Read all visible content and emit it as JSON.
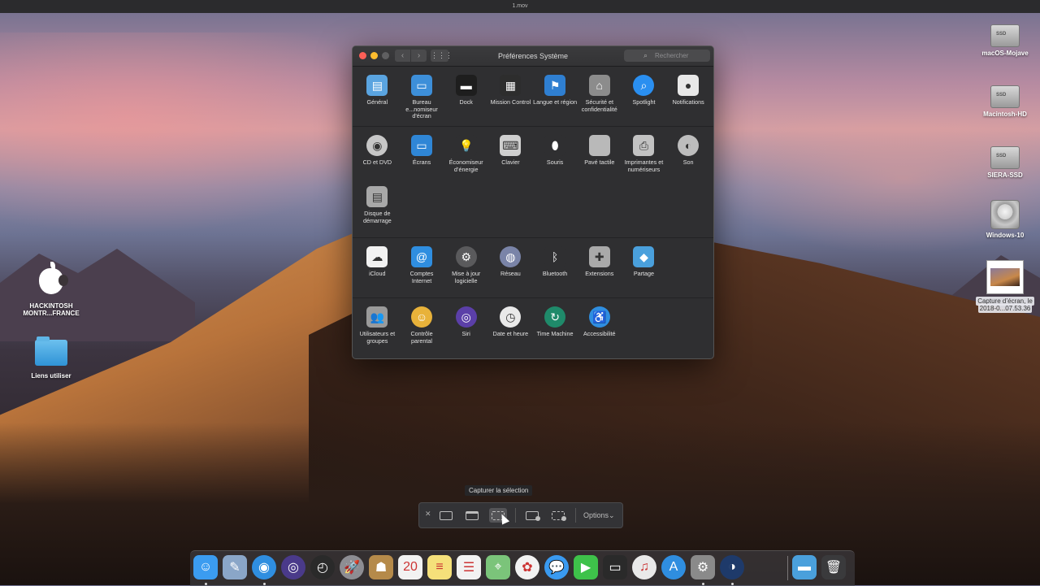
{
  "topbar": {
    "title": "1.mov"
  },
  "desktop": {
    "right": [
      {
        "label": "macOS-Mojave"
      },
      {
        "label": "Macintosh-HD"
      },
      {
        "label": "SIERA-SSD"
      },
      {
        "label": "Windows-10"
      },
      {
        "label1": "Capture d’écran, le",
        "label2": "2018-0...07.53.36"
      }
    ],
    "left": [
      {
        "label1": "HACKINTOSH",
        "label2": "MONTR...FRANCE"
      },
      {
        "label": "Liens utiliser"
      }
    ]
  },
  "window": {
    "title": "Préférences Système",
    "search_placeholder": "Rechercher",
    "back": "‹",
    "forward": "›",
    "grid": "⋮⋮⋮",
    "row1": [
      {
        "label": "Général",
        "icon": "general-icon",
        "color": "#5aa4e0",
        "glyph": "▤"
      },
      {
        "label": "Bureau e...nomiseur d'écran",
        "icon": "desktop-screensaver-icon",
        "color": "#3d8fd9",
        "glyph": "▭"
      },
      {
        "label": "Dock",
        "icon": "dock-icon",
        "color": "#1e1e1e",
        "glyph": "▬"
      },
      {
        "label": "Mission Control",
        "icon": "mission-control-icon",
        "color": "#2d2d2d",
        "glyph": "▦"
      },
      {
        "label": "Langue et région",
        "icon": "language-region-icon",
        "color": "#2f7fd1",
        "glyph": "⚑"
      },
      {
        "label": "Sécurité et confidentialité",
        "icon": "security-icon",
        "color": "#8c8c8c",
        "glyph": "⌂"
      },
      {
        "label": "Spotlight",
        "icon": "spotlight-icon",
        "color": "#2a8ff0",
        "glyph": "⌕"
      },
      {
        "label": "Notifications",
        "icon": "notifications-icon",
        "color": "#e8e8e8",
        "glyph": "●"
      }
    ],
    "row2": [
      {
        "label": "CD et DVD",
        "icon": "cd-dvd-icon",
        "color": "#c7c7c7",
        "glyph": "◉"
      },
      {
        "label": "Écrans",
        "icon": "displays-icon",
        "color": "#2f86d6",
        "glyph": "▭"
      },
      {
        "label": "Économiseur d’énergie",
        "icon": "energy-saver-icon",
        "color": "#2f2f31",
        "glyph": "💡"
      },
      {
        "label": "Clavier",
        "icon": "keyboard-icon",
        "color": "#cfcfcf",
        "glyph": "⌨"
      },
      {
        "label": "Souris",
        "icon": "mouse-icon",
        "color": "#2f2f31",
        "glyph": "⬮"
      },
      {
        "label": "Pavé tactile",
        "icon": "trackpad-icon",
        "color": "#b9b9b9",
        "glyph": ""
      },
      {
        "label": "Imprimantes et numériseurs",
        "icon": "printer-icon",
        "color": "#c2c2c2",
        "glyph": "⎙"
      },
      {
        "label": "Son",
        "icon": "sound-icon",
        "color": "#bdbdbd",
        "glyph": "◐"
      },
      {
        "label": "Disque de démarrage",
        "icon": "startup-disk-icon",
        "color": "#a8a8a8",
        "glyph": "▤"
      }
    ],
    "row3": [
      {
        "label": "iCloud",
        "icon": "icloud-icon",
        "color": "#f2f2f2",
        "glyph": "☁"
      },
      {
        "label": "Comptes Internet",
        "icon": "internet-accounts-icon",
        "color": "#2f8ee0",
        "glyph": "@"
      },
      {
        "label": "Mise à jour logicielle",
        "icon": "software-update-icon",
        "color": "#5a5a5c",
        "glyph": "⚙"
      },
      {
        "label": "Réseau",
        "icon": "network-icon",
        "color": "#7a84a8",
        "glyph": "◍"
      },
      {
        "label": "Bluetooth",
        "icon": "bluetooth-icon",
        "color": "#2f2f31",
        "glyph": "ᛒ"
      },
      {
        "label": "Extensions",
        "icon": "extensions-icon",
        "color": "#a9a9a9",
        "glyph": "✚"
      },
      {
        "label": "Partage",
        "icon": "sharing-icon",
        "color": "#4aa0dc",
        "glyph": "◆"
      }
    ],
    "row4": [
      {
        "label": "Utilisateurs et groupes",
        "icon": "users-groups-icon",
        "color": "#9a9a9a",
        "glyph": "👥"
      },
      {
        "label": "Contrôle parental",
        "icon": "parental-controls-icon",
        "color": "#e8b23a",
        "glyph": "☺"
      },
      {
        "label": "Siri",
        "icon": "siri-icon",
        "color": "#5b3fa8",
        "glyph": "◎"
      },
      {
        "label": "Date et heure",
        "icon": "date-time-icon",
        "color": "#e9e9e9",
        "glyph": "◷"
      },
      {
        "label": "Time Machine",
        "icon": "time-machine-icon",
        "color": "#1f8a6a",
        "glyph": "↻"
      },
      {
        "label": "Accessibilité",
        "icon": "accessibility-icon",
        "color": "#2f8ee0",
        "glyph": "♿"
      }
    ]
  },
  "capture": {
    "tooltip": "Capturer la sélection",
    "close": "✕",
    "options": "Options",
    "chevron": "⌄"
  },
  "dock": [
    {
      "icon": "finder-icon",
      "color": "#3b9cf0",
      "glyph": "☺",
      "running": true
    },
    {
      "icon": "preview-icon",
      "color": "#8aa6c8",
      "glyph": "✎",
      "running": false
    },
    {
      "icon": "safari-icon",
      "color": "#2f8ee0",
      "glyph": "◉",
      "running": true
    },
    {
      "icon": "siri-icon",
      "color": "#4a3a8a",
      "glyph": "◎",
      "running": false
    },
    {
      "icon": "dashboard-icon",
      "color": "#2a2a2a",
      "glyph": "◴",
      "running": false
    },
    {
      "icon": "launchpad-icon",
      "color": "#8d8d93",
      "glyph": "🚀",
      "running": false
    },
    {
      "icon": "contacts-icon",
      "color": "#b58a4a",
      "glyph": "☗",
      "running": false
    },
    {
      "icon": "calendar-icon",
      "color": "#f2f2f2",
      "glyph": "20",
      "running": false
    },
    {
      "icon": "notes-icon",
      "color": "#f5e07a",
      "glyph": "≡",
      "running": false
    },
    {
      "icon": "reminders-icon",
      "color": "#f2f2f2",
      "glyph": "☰",
      "running": false
    },
    {
      "icon": "maps-icon",
      "color": "#7bc47a",
      "glyph": "⌖",
      "running": false
    },
    {
      "icon": "photos-icon",
      "color": "#f2f2f2",
      "glyph": "✿",
      "running": false
    },
    {
      "icon": "messages-icon",
      "color": "#3a9af0",
      "glyph": "💬",
      "running": false
    },
    {
      "icon": "facetime-icon",
      "color": "#3ec24a",
      "glyph": "▶",
      "running": false
    },
    {
      "icon": "photo-booth-icon",
      "color": "#2a2a2a",
      "glyph": "▭",
      "running": false
    },
    {
      "icon": "itunes-icon",
      "color": "#e9e9e9",
      "glyph": "♫",
      "running": false
    },
    {
      "icon": "app-store-icon",
      "color": "#2f8ee0",
      "glyph": "A",
      "running": false
    },
    {
      "icon": "system-preferences-icon",
      "color": "#8a8a8a",
      "glyph": "⚙",
      "running": true
    },
    {
      "icon": "clover-configurator-icon",
      "color": "#1e3a6a",
      "glyph": "◑",
      "running": true
    },
    {
      "icon": "downloads-folder-icon",
      "color": "#4aa0dc",
      "glyph": "▬",
      "running": false
    },
    {
      "icon": "trash-icon",
      "color": "#3a3a3c",
      "glyph": "🗑",
      "running": false
    }
  ]
}
